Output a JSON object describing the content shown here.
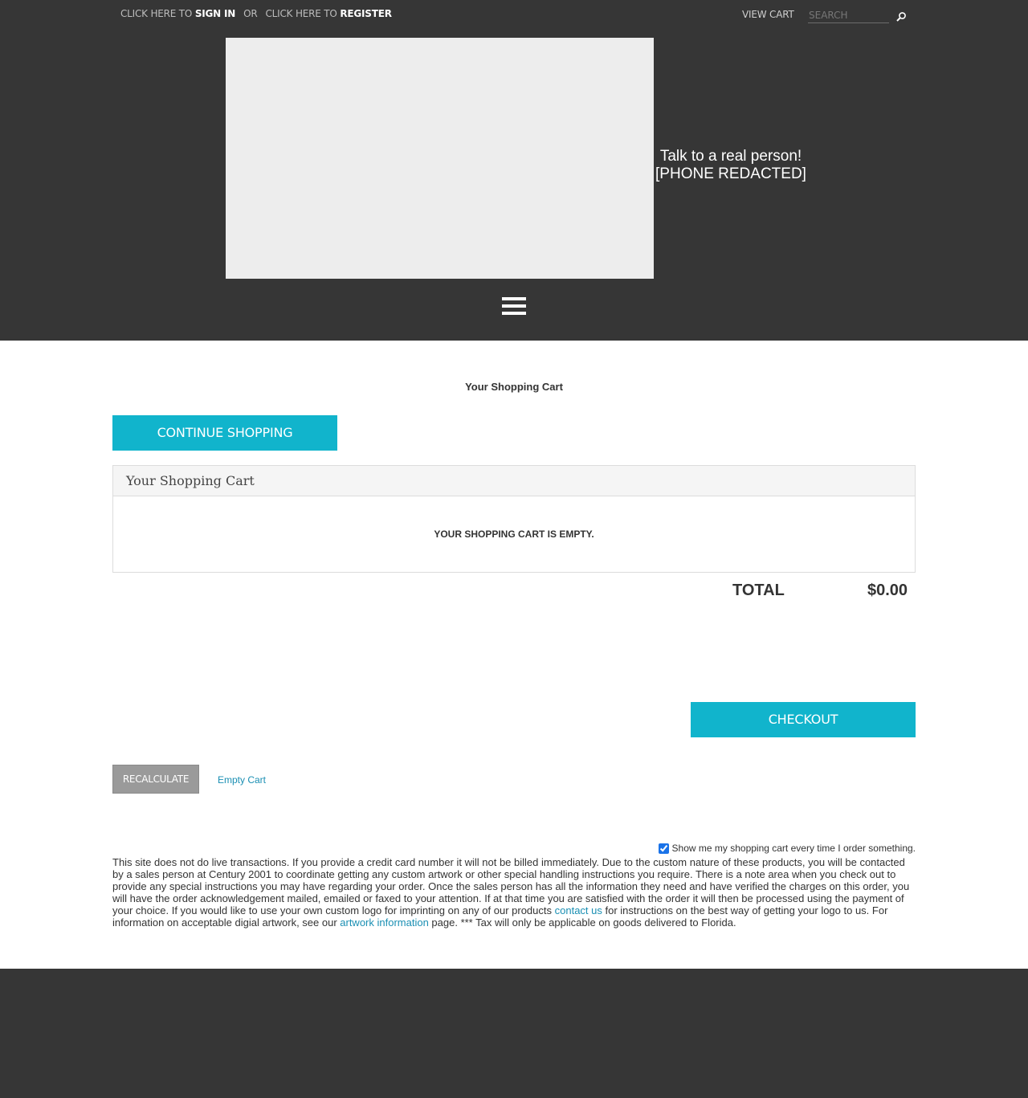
{
  "topbar": {
    "signin_prefix": "CLICK HERE TO",
    "signin_label": "SIGN IN",
    "or_label": "OR",
    "register_prefix": "CLICK HERE TO",
    "register_label": "REGISTER",
    "view_cart_label": "VIEW CART",
    "search_placeholder": "SEARCH",
    "search_icon": "magnifier-icon"
  },
  "phone": {
    "line1": "Talk to a real person!",
    "line2": "[PHONE REDACTED]"
  },
  "menu_icon": "hamburger-icon",
  "page_title": "Your Shopping Cart",
  "continue_label": "CONTINUE SHOPPING",
  "cart": {
    "title": "Your Shopping Cart",
    "empty_message": "YOUR SHOPPING CART IS EMPTY.",
    "total_label": "TOTAL",
    "total_value": "$0.00"
  },
  "checkout_label": "CHECKOUT",
  "recalculate_label": "RECALCULATE",
  "empty_cart_label": "Empty Cart",
  "show_cart": {
    "checked": true,
    "label": "Show me my shopping cart every time I order something."
  },
  "notice": {
    "part1": "This site does not do live transactions. If you provide a credit card number it will not be billed immediately. Due to the custom nature of these products, you will be contacted by a sales person at Century 2001 to coordinate getting any custom artwork or other special handling instructions you require. There is a note area when you check out to provide any special instructions you may have regarding your order. Once the sales person has all the information they need and have verified the charges on this order, you will have the order acknowledgement mailed, emailed or faxed to your attention. If at that time you are satisfied with the order it will then be processed using the payment of your choice. If you would like to use your own custom logo for imprinting on any of our products ",
    "contact_link": "contact us",
    "part2": " for instructions on the best way of getting your logo to us. For information on acceptable digial artwork, see our ",
    "artwork_link": "artwork information",
    "part3": " page. *** Tax will only be applicable on goods delivered to Florida."
  },
  "colors": {
    "header_bg": "#363636",
    "accent": "#11b4cc",
    "link": "#1a8fb3"
  }
}
